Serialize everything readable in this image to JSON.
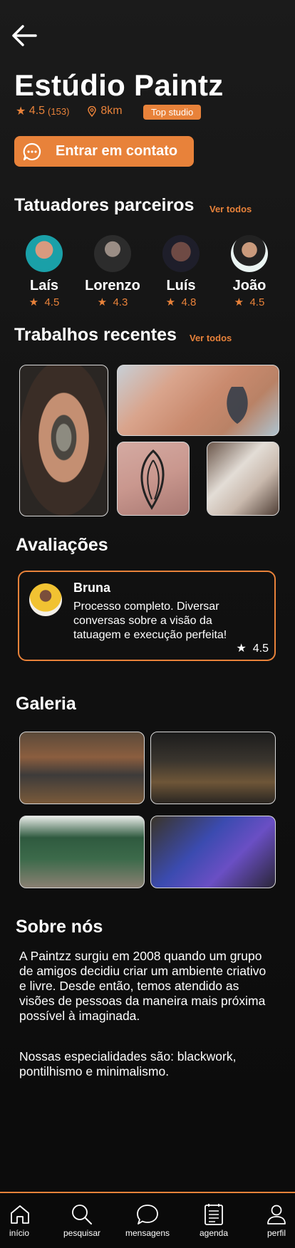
{
  "studio": {
    "name": "Estúdio Paintz",
    "rating": "4.5",
    "reviews_count": "(153)",
    "distance": "8km",
    "badge": "Top studio",
    "contact_label": "Entrar em contato"
  },
  "artists_section": {
    "title": "Tatuadores parceiros",
    "see_all": "Ver todos",
    "items": [
      {
        "name": "Laís",
        "rating": "4.5"
      },
      {
        "name": "Lorenzo",
        "rating": "4.3"
      },
      {
        "name": "Luís",
        "rating": "4.8"
      },
      {
        "name": "João",
        "rating": "4.5"
      }
    ]
  },
  "works_section": {
    "title": "Trabalhos recentes",
    "see_all": "Ver todos"
  },
  "reviews_section": {
    "title": "Avaliações",
    "review": {
      "author": "Bruna",
      "text": "Processo completo. Diversar conversas sobre a visão da tatuagem e execução perfeita!",
      "rating": "4.5"
    }
  },
  "gallery_section": {
    "title": "Galeria"
  },
  "about_section": {
    "title": "Sobre nós",
    "p1": "A Paintzz surgiu em 2008 quando um grupo de amigos decidiu criar um ambiente criativo e livre. Desde então, temos atendido as visões de pessoas da maneira mais próxima possível à imaginada.",
    "p2": "Nossas especialidades são: blackwork, pontilhismo e minimalismo."
  },
  "nav": {
    "items": [
      {
        "label": "início",
        "icon": "home-icon"
      },
      {
        "label": "pesquisar",
        "icon": "search-icon"
      },
      {
        "label": "mensagens",
        "icon": "chat-icon"
      },
      {
        "label": "agenda",
        "icon": "calendar-icon"
      },
      {
        "label": "perfil",
        "icon": "user-icon"
      }
    ]
  },
  "colors": {
    "accent": "#E8823A",
    "background": "#121212",
    "text": "#FFFFFF"
  }
}
